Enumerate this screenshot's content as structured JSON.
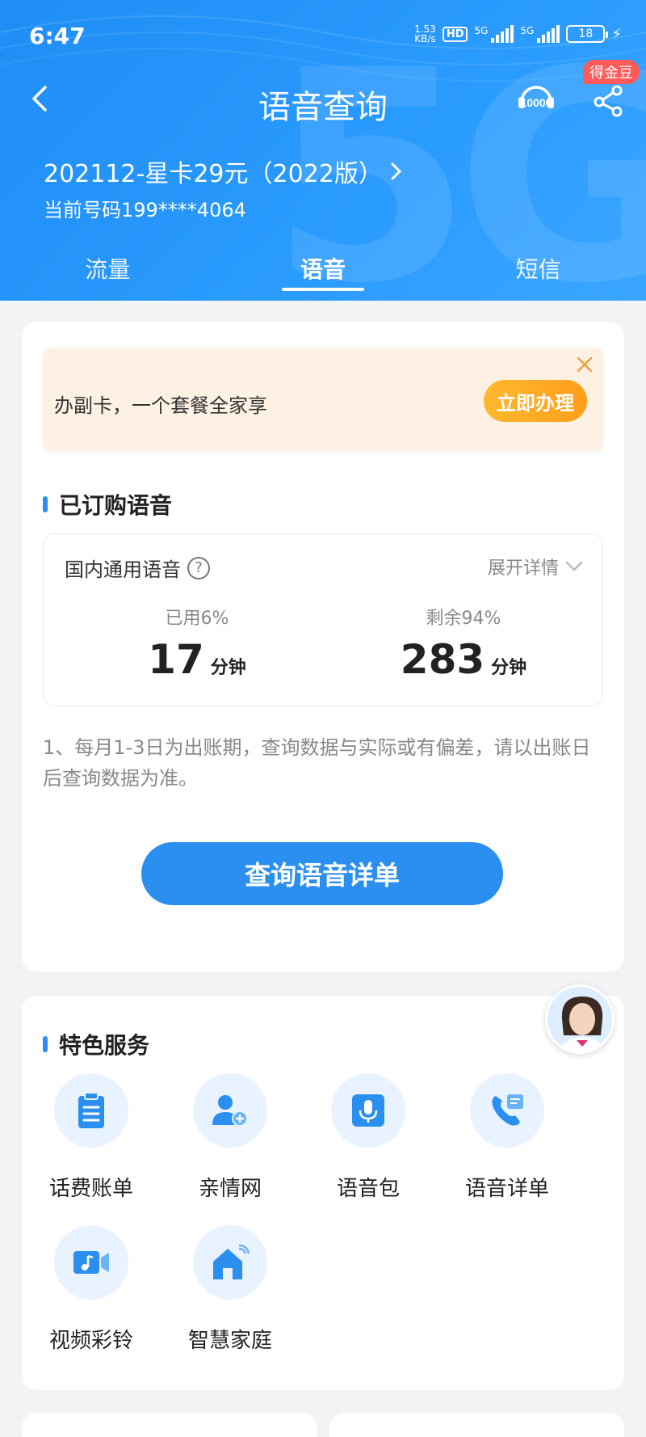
{
  "status_bar": {
    "time": "6:47",
    "speed_value": "1.53",
    "speed_unit": "KB/s",
    "hd": "HD",
    "net1": "5G",
    "net2": "5G",
    "battery": "18"
  },
  "nav": {
    "title": "语音查询",
    "coin_badge": "得金豆",
    "hotline_icon": "hotline-10000-icon"
  },
  "plan": {
    "name": "202112-星卡29元（2022版）",
    "phone_label": "当前号码199****4064"
  },
  "tabs": [
    {
      "label": "流量",
      "active": false
    },
    {
      "label": "语音",
      "active": true
    },
    {
      "label": "短信",
      "active": false
    }
  ],
  "promo": {
    "text": "办副卡，一个套餐全家享",
    "button": "立即办理"
  },
  "subscribed": {
    "title": "已订购语音",
    "item_name": "国内通用语音",
    "expand_label": "展开详情",
    "used_label": "已用6%",
    "used_value": "17",
    "remaining_label": "剩余94%",
    "remaining_value": "283",
    "unit": "分钟",
    "used_percent": 6
  },
  "note": "1、每月1-3日为出账期，查询数据与实际或有偏差，请以出账日后查询数据为准。",
  "query_button": "查询语音详单",
  "services": {
    "title": "特色服务",
    "items": [
      {
        "label": "话费账单",
        "icon": "bill-clipboard-icon"
      },
      {
        "label": "亲情网",
        "icon": "family-network-icon"
      },
      {
        "label": "语音包",
        "icon": "voice-pack-icon"
      },
      {
        "label": "语音详单",
        "icon": "call-detail-icon"
      },
      {
        "label": "视频彩铃",
        "icon": "video-ringtone-icon"
      },
      {
        "label": "智慧家庭",
        "icon": "smart-home-icon"
      }
    ]
  },
  "colors": {
    "primary": "#2b8ff0",
    "header": "#2196f3",
    "promo_bg": "#fdf1e3",
    "promo_button": "#ffa726",
    "badge": "#ff5a5a"
  }
}
